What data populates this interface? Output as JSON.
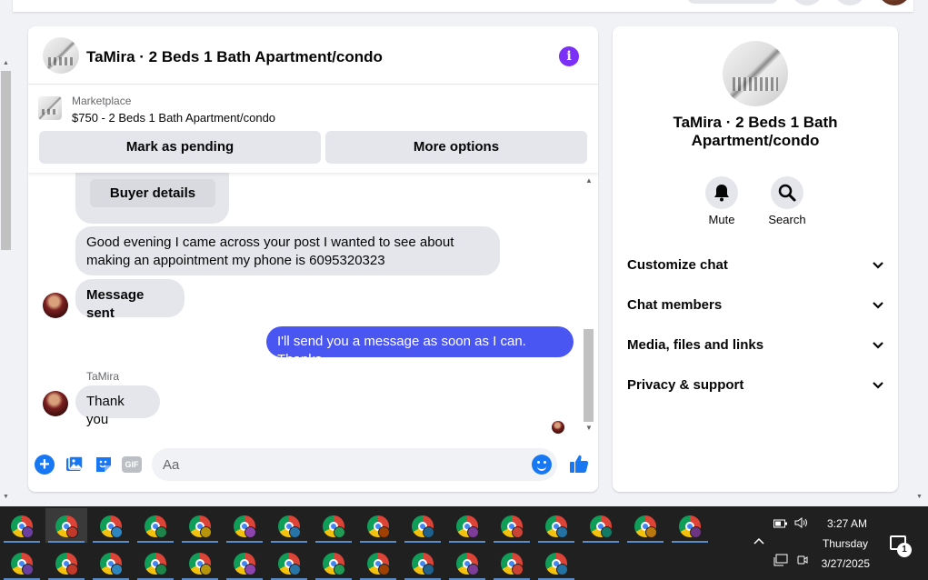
{
  "chat": {
    "title": "TaMira · 2 Beds 1 Bath Apartment/condo",
    "info_icon": "info-icon",
    "marketplace": {
      "label": "Marketplace",
      "price_line": "$750 - 2 Beds 1 Bath Apartment/condo",
      "pending_label": "Mark as pending",
      "more_label": "More options"
    },
    "messages": {
      "buyer_details_label": "Buyer details",
      "incoming_1": "Good evening I came across your post I wanted to see about making an appointment my phone is 6095320323",
      "incoming_2": "Message sent",
      "outgoing_1": "I'll send you a message as soon as I can. Thanks",
      "sender_name": "TaMira",
      "incoming_3": "Thank you"
    },
    "composer": {
      "placeholder": "Aa",
      "gif_label": "GIF"
    },
    "colors": {
      "outgoing_bubble": "#4a56f2",
      "accent": "#1877f2",
      "info": "#7b2ff7"
    }
  },
  "details": {
    "title": "TaMira · 2 Beds 1 Bath Apartment/condo",
    "actions": [
      {
        "label": "Mute",
        "icon": "bell-icon"
      },
      {
        "label": "Search",
        "icon": "search-icon"
      }
    ],
    "sections": [
      "Customize chat",
      "Chat members",
      "Media, files and links",
      "Privacy & support"
    ]
  },
  "taskbar": {
    "time": "3:27 AM",
    "day": "Thursday",
    "date": "3/27/2025",
    "notification_count": "1"
  }
}
